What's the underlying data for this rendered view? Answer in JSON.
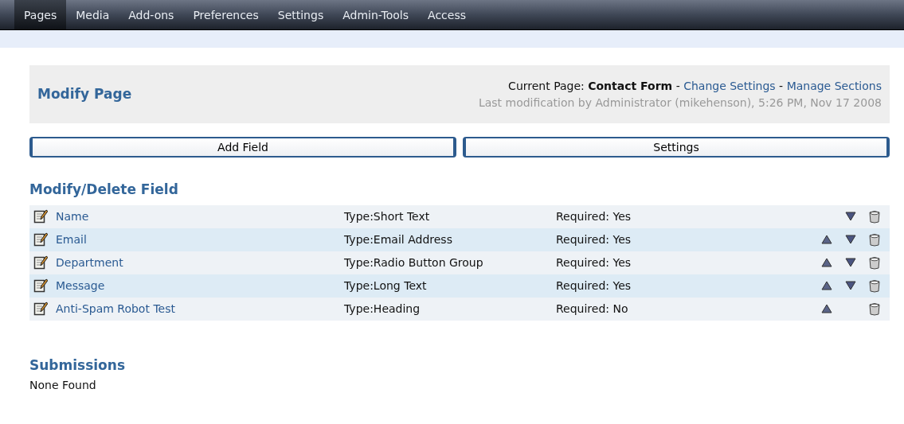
{
  "menu": [
    {
      "label": "Pages",
      "selected": true
    },
    {
      "label": "Media",
      "selected": false
    },
    {
      "label": "Add-ons",
      "selected": false
    },
    {
      "label": "Preferences",
      "selected": false
    },
    {
      "label": "Settings",
      "selected": false
    },
    {
      "label": "Admin-Tools",
      "selected": false
    },
    {
      "label": "Access",
      "selected": false
    }
  ],
  "header": {
    "title": "Modify Page",
    "current_label": "Current Page:",
    "current_page": "Contact Form",
    "separator_1": "-",
    "change_settings": "Change Settings",
    "separator_2": "-",
    "manage_sections": "Manage Sections",
    "last_modification": "Last modification by Administrator (mikehenson), 5:26 PM, Nov 17 2008"
  },
  "buttons": [
    "Add Field",
    "Settings"
  ],
  "fields_heading": "Modify/Delete Field",
  "fields": [
    {
      "name": "Name",
      "type": "Type:Short Text",
      "required": "Required: Yes",
      "can_move_up": false,
      "can_move_down": true
    },
    {
      "name": "Email",
      "type": "Type:Email Address",
      "required": "Required: Yes",
      "can_move_up": true,
      "can_move_down": true
    },
    {
      "name": "Department",
      "type": "Type:Radio Button Group",
      "required": "Required: Yes",
      "can_move_up": true,
      "can_move_down": true
    },
    {
      "name": "Message",
      "type": "Type:Long Text",
      "required": "Required: Yes",
      "can_move_up": true,
      "can_move_down": true
    },
    {
      "name": "Anti-Spam Robot Test",
      "type": "Type:Heading",
      "required": "Required: No",
      "can_move_up": true,
      "can_move_down": false
    }
  ],
  "submissions": {
    "heading": "Submissions",
    "text": "None Found"
  }
}
